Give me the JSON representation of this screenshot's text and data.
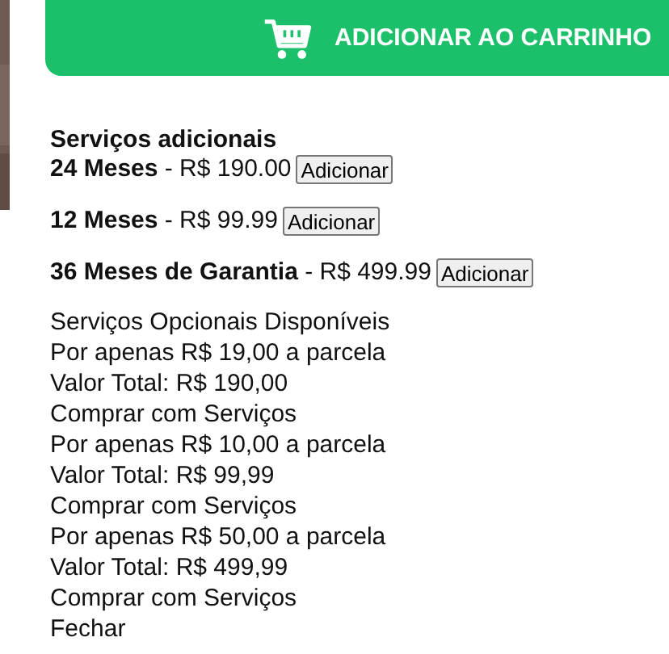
{
  "cart_button": {
    "label": "ADICIONAR AO CARRINHO"
  },
  "services": {
    "title": "Serviços adicionais",
    "options": [
      {
        "text": "**24 Meses** - R$ 190.00",
        "button": "Adicionar"
      },
      {
        "text": "**12 Meses** - R$ 99.99",
        "button": "Adicionar"
      },
      {
        "text": "**36 Meses de Garantia** - R$ 499.99",
        "button": "Adicionar"
      }
    ]
  },
  "lines": [
    "Serviços Opcionais Disponíveis",
    "Por apenas R$ 19,00 a parcela",
    "Valor Total: R$ 190,00",
    "Comprar com Serviços",
    "Por apenas R$ 10,00 a parcela",
    "Valor Total: R$ 99,99",
    "Comprar com Serviços",
    "Por apenas R$ 50,00 a parcela",
    "Valor Total: R$ 499,99",
    "Comprar com Serviços",
    "Fechar"
  ]
}
